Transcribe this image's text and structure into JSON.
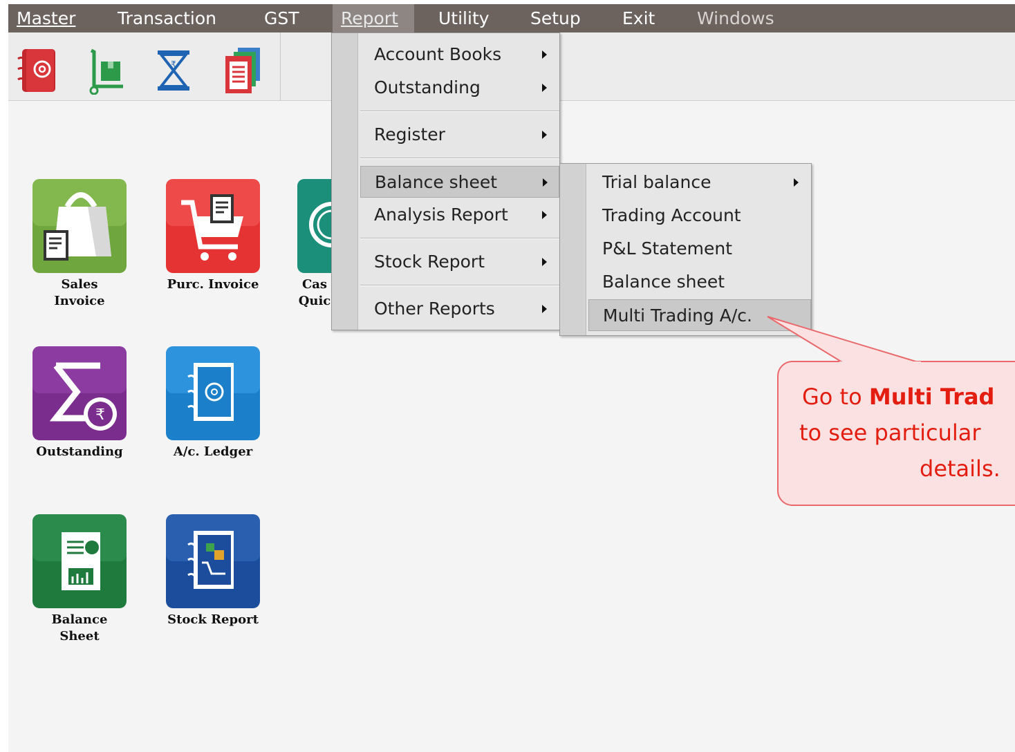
{
  "menubar": {
    "master": "Master",
    "transaction": "Transaction",
    "gst": "GST",
    "report": "Report",
    "utility": "Utility",
    "setup": "Setup",
    "exit": "Exit",
    "windows": "Windows"
  },
  "toolbar": {
    "icons": [
      "address-book-icon",
      "trolley-box-icon",
      "hourglass-rupee-icon",
      "documents-icon"
    ]
  },
  "tiles": {
    "sales_invoice_1": "Sales",
    "sales_invoice_2": "Invoice",
    "purc_invoice": "Purc. Invoice",
    "cash_quick_1": "Cas",
    "cash_quick_2": "Quic",
    "outstanding": "Outstanding",
    "ac_ledger": "A/c. Ledger",
    "balance_sheet_1": "Balance",
    "balance_sheet_2": "Sheet",
    "stock_report": "Stock Report"
  },
  "report_menu": {
    "account_books": "Account Books",
    "outstanding": "Outstanding",
    "register": "Register",
    "balance_sheet": "Balance sheet",
    "analysis_report": "Analysis Report",
    "stock_report": "Stock Report",
    "other_reports": "Other Reports"
  },
  "balance_submenu": {
    "trial_balance": "Trial balance",
    "trading_account": "Trading Account",
    "pl_statement": "P&L Statement",
    "balance_sheet": "Balance sheet",
    "multi_trading": "Multi Trading A/c."
  },
  "callout": {
    "line1_pre": "Go to ",
    "line1_bold": "Multi Trad",
    "line2": "to see particular",
    "line3": "details."
  },
  "colors": {
    "menubar": "#6d635e",
    "callout_text": "#e31e10",
    "callout_bg": "#fbe1e1",
    "callout_border": "#e9686b"
  }
}
